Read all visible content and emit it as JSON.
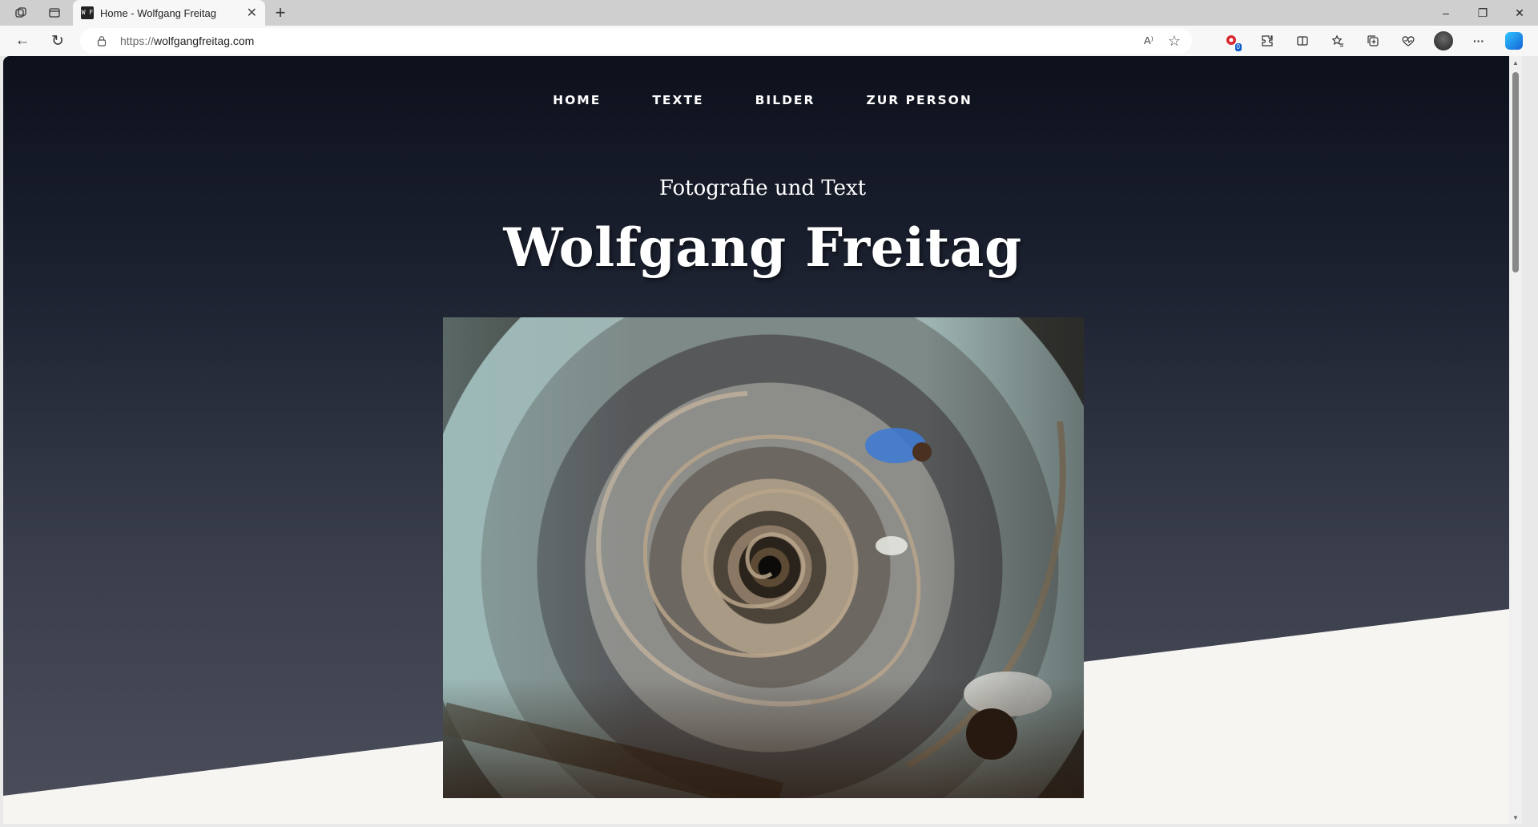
{
  "browser": {
    "tab": {
      "title": "Home - Wolfgang Freitag",
      "favicon_text": "W F"
    },
    "address": {
      "protocol": "https://",
      "domain": "wolfgangfreitag.com"
    },
    "icons": {
      "workspaces": "workspaces-icon",
      "tab_actions": "tab-actions-icon",
      "new_tab": "+",
      "close_tab": "✕",
      "minimize": "–",
      "restore": "❐",
      "close_window": "✕",
      "back": "←",
      "refresh": "↻",
      "read_aloud": "A⁾",
      "favorite": "☆",
      "extensions_badge": "0",
      "more": "···"
    }
  },
  "site": {
    "nav": [
      "HOME",
      "TEXTE",
      "BILDER",
      "ZUR PERSON"
    ],
    "subtitle": "Fotografie und Text",
    "title": "Wolfgang Freitag",
    "colors": {
      "hero_top": "#0d111c",
      "hero_bottom": "#4b4e5a",
      "page_background": "#f6f5f2",
      "text": "#ffffff"
    }
  }
}
